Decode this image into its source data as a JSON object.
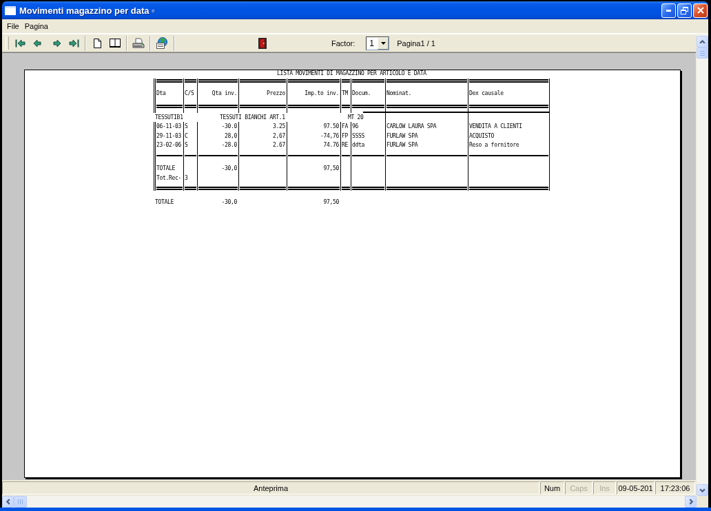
{
  "window": {
    "title": "Movimenti magazzino per data ▫"
  },
  "menu": [
    {
      "label": "File"
    },
    {
      "label": "Pagina"
    }
  ],
  "toolbar": {
    "factor_label": "Factor:",
    "factor_value": "1",
    "page_label": "Pagina1 / 1"
  },
  "report": {
    "title": "LISTA MOVIMENTI DI MAGAZZINO PER ARTICOLO E DATA",
    "columns": [
      "Dta",
      "C/S",
      "Qta inv.",
      "Prezzo",
      "Imp.to inv.",
      "TM",
      "Docum.",
      "Nominat.",
      "Dex causale"
    ],
    "group": {
      "code": "TESSUTIB1",
      "description": "TESSUTI BIANCHI ART.1",
      "unit": "MT 20"
    },
    "rows": [
      [
        "06-11-03",
        "S",
        "-30.0",
        "3.25",
        "97.50",
        "FA",
        "96",
        "CARLOW LAURA SPA",
        "VENDITA A CLIENTI"
      ],
      [
        "29-11-03",
        "C",
        "28,0",
        "2,67",
        "-74,76",
        "FP",
        "SSSS",
        "FURLAW SPA",
        "ACQUISTO"
      ],
      [
        "23-02-06",
        "S",
        "-28.0",
        "2.67",
        "74.76",
        "RE",
        "ddta",
        "FURLAW SPA",
        "Reso a fornitore"
      ]
    ],
    "totals": {
      "label": "TOTALE",
      "qta_inv": "-30,0",
      "imp_to_inv": "97,50"
    },
    "record_count": {
      "label": "Tot.Rec-",
      "value": "3"
    },
    "grand_total": {
      "label": "TOTALE",
      "qta_inv": "-30,0",
      "imp_to_inv": "97,50"
    }
  },
  "status_bar": {
    "message": "Anteprima",
    "indicators": [
      {
        "label": "Num",
        "on": true
      },
      {
        "label": "Caps",
        "on": false
      },
      {
        "label": "Ins",
        "on": false
      }
    ],
    "date": "09-05-201",
    "time": "17:23:06"
  }
}
